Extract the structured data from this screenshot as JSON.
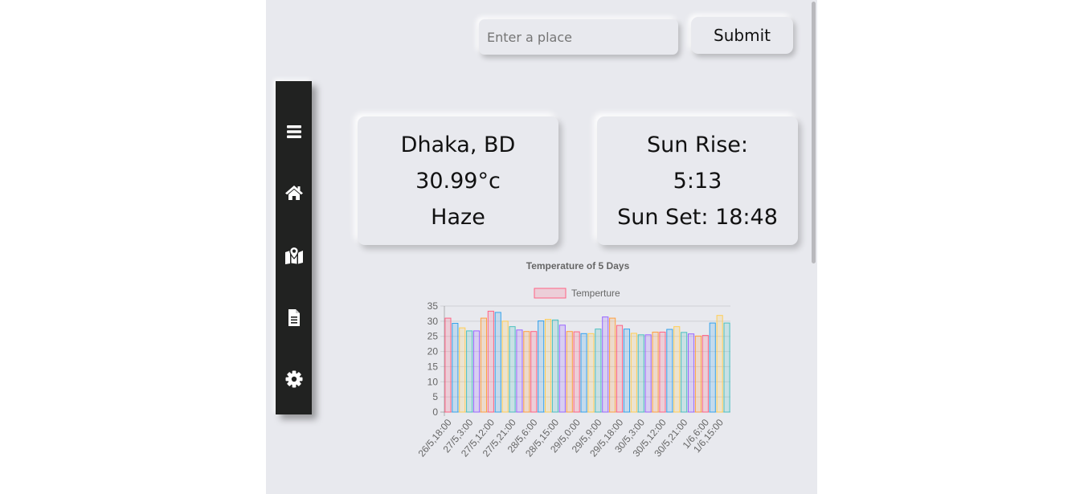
{
  "search": {
    "placeholder": "Enter a place",
    "value": ""
  },
  "submit_label": "Submit",
  "sidebar": {
    "items": [
      {
        "icon": "menu-icon"
      },
      {
        "icon": "home-icon"
      },
      {
        "icon": "map-location-icon"
      },
      {
        "icon": "document-icon"
      },
      {
        "icon": "settings-gear-icon"
      }
    ]
  },
  "weather_card": {
    "location": "Dhaka, BD",
    "temperature": "30.99°c",
    "condition": "Haze"
  },
  "sun_card": {
    "sunrise_line1": "Sun Rise:",
    "sunrise_line2": "5:13",
    "sunset": "Sun Set: 18:48"
  },
  "chart_data": {
    "type": "bar",
    "title": "Temperature of 5 Days",
    "series": [
      {
        "name": "Temperture",
        "values": [
          31.0,
          29.3,
          27.8,
          26.8,
          26.8,
          31.0,
          33.3,
          32.9,
          30.0,
          28.2,
          27.1,
          26.6,
          26.6,
          30.1,
          30.6,
          30.4,
          28.7,
          26.6,
          26.5,
          25.9,
          25.9,
          27.4,
          31.4,
          31.0,
          28.6,
          27.4,
          26.0,
          25.5,
          25.5,
          26.4,
          26.4,
          27.3,
          28.2,
          26.3,
          25.8,
          25.1,
          25.3,
          29.4,
          31.9,
          29.4
        ]
      }
    ],
    "categories": [
      "26/5,18:00",
      "",
      "",
      "27/5,3:00",
      "",
      "",
      "27/5,12:00",
      "",
      "",
      "27/5,21:00",
      "",
      "",
      "28/5,6:00",
      "",
      "",
      "28/5,15:00",
      "",
      "",
      "29/5,0:00",
      "",
      "",
      "29/5,9:00",
      "",
      "",
      "29/5,18:00",
      "",
      "",
      "30/5,3:00",
      "",
      "",
      "30/5,12:00",
      "",
      "",
      "30/5,21:00",
      "",
      "",
      "1/6,6:00",
      "",
      "1/6,15:00",
      ""
    ],
    "ylim": [
      0,
      35
    ],
    "yticks": [
      0,
      5,
      10,
      15,
      20,
      25,
      30,
      35
    ],
    "legend_position": "top",
    "grid": true,
    "colors": [
      {
        "fill": "rgba(255,99,132,0.2)",
        "stroke": "rgba(255,99,132,1)"
      },
      {
        "fill": "rgba(54,162,235,0.2)",
        "stroke": "rgba(54,162,235,1)"
      },
      {
        "fill": "rgba(255,206,86,0.2)",
        "stroke": "rgba(255,206,86,1)"
      },
      {
        "fill": "rgba(75,192,192,0.2)",
        "stroke": "rgba(75,192,192,1)"
      },
      {
        "fill": "rgba(153,102,255,0.2)",
        "stroke": "rgba(153,102,255,1)"
      },
      {
        "fill": "rgba(255,159,64,0.2)",
        "stroke": "rgba(255,159,64,1)"
      }
    ]
  }
}
